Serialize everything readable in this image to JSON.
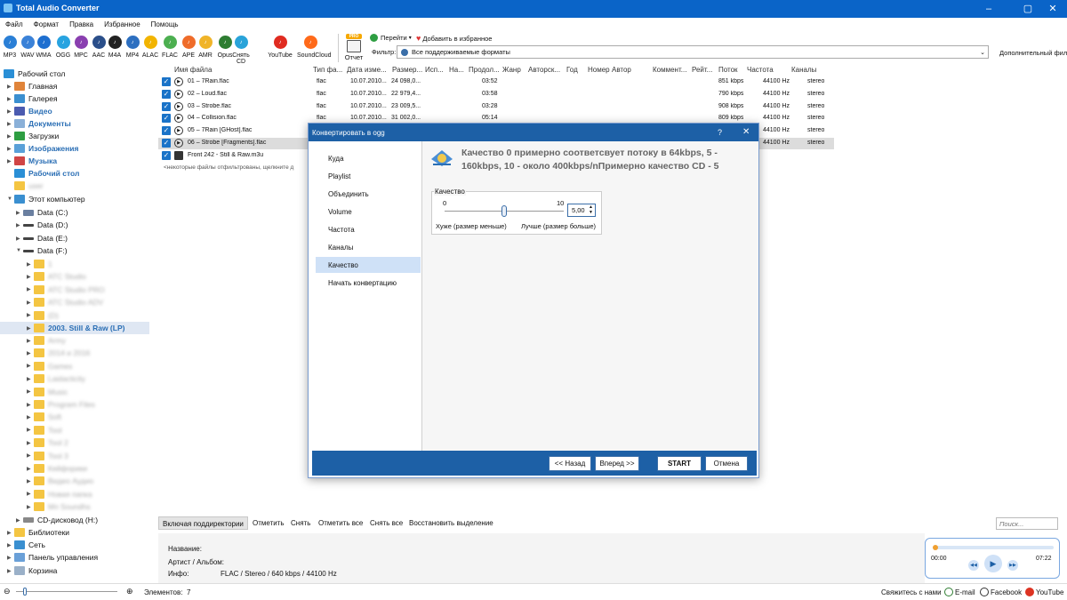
{
  "window": {
    "title": "Total Audio Converter",
    "controls": [
      "–",
      "▢",
      "✕"
    ]
  },
  "menu": [
    "Файл",
    "Формат",
    "Правка",
    "Избранное",
    "Помощь"
  ],
  "formats": [
    {
      "label": "MP3",
      "color": "#2a7fd6"
    },
    {
      "label": "WAV",
      "color": "#3b82d8"
    },
    {
      "label": "WMA",
      "color": "#1e6fd0"
    },
    {
      "label": "OGG",
      "color": "#28a3e0"
    },
    {
      "label": "MPC",
      "color": "#8a3fb0"
    },
    {
      "label": "AAC",
      "color": "#2b4f8a"
    },
    {
      "label": "M4A",
      "color": "#222222"
    },
    {
      "label": "MP4",
      "color": "#2d6fc0"
    },
    {
      "label": "ALAC",
      "color": "#f2b400"
    },
    {
      "label": "FLAC",
      "color": "#4caf50"
    },
    {
      "label": "APE",
      "color": "#ef6c2a"
    },
    {
      "label": "AMR",
      "color": "#f0b429"
    },
    {
      "label": "Opus",
      "color": "#2e7d32"
    },
    {
      "label": "Снять CD",
      "color": "#29a3d9"
    },
    {
      "label": "YouTube",
      "color": "#e02b20"
    },
    {
      "label": "SoundCloud",
      "color": "#ff6a1a"
    }
  ],
  "report": {
    "label": "Отчет",
    "badge": "PRO"
  },
  "nav": {
    "goto": "Перейти",
    "fav": "Добавить в избранное",
    "filter_label": "Фильтр:",
    "filter_value": "Все поддерживаемые форматы",
    "advanced": "Дополнительный фильт"
  },
  "tree": {
    "desktop": "Рабочий стол",
    "home": "Главная",
    "gallery": "Галерея",
    "video": "Видео",
    "docs": "Документы",
    "downloads": "Загрузки",
    "images": "Изображения",
    "music": "Музыка",
    "desktop2": "Рабочий стол",
    "blurred_user": "user",
    "pc": "Этот компьютер",
    "drives": [
      "Data (C:)",
      "Data (D:)",
      "Data (E:)",
      "Data (F:)"
    ],
    "folders_before": [
      "1",
      "ATC Studio",
      "ATC Studio PRO",
      "ATC Studio ADV",
      "(D)"
    ],
    "selected_folder": "2003. Still & Raw (LP)",
    "folders_after": [
      "Army",
      "2014 и 2016",
      "Games",
      "Laidacticity",
      "Music",
      "Program Files",
      "Soft",
      "Tool",
      "Tool 2",
      "Tool 3",
      "Кейфорики",
      "Видео Аудио",
      "Новая папка",
      "Мп Soundhs"
    ],
    "cd": "CD-дисковод (H:)",
    "libraries": "Библиотеки",
    "network": "Сеть",
    "control": "Панель управления",
    "trash": "Корзина"
  },
  "columns": [
    "Имя файла",
    "Тип фа...",
    "Дата изме...",
    "Размер...",
    "Исп...",
    "На...",
    "Продол...",
    "Жанр",
    "Авторск...",
    "Год",
    "Номер",
    "Автор",
    "Коммент...",
    "Рейт...",
    "Поток",
    "Частота",
    "Каналы"
  ],
  "files": [
    {
      "name": "01 – 7Rain.flac",
      "type": "flac",
      "date": "10.07.2010...",
      "size": "24 098,0...",
      "dur": "03:52",
      "bitrate": "851 kbps",
      "freq": "44100 Hz",
      "ch": "stereo",
      "checked": true,
      "selected": false
    },
    {
      "name": "02 – Loud.flac",
      "type": "flac",
      "date": "10.07.2010...",
      "size": "22 979,4...",
      "dur": "03:58",
      "bitrate": "790 kbps",
      "freq": "44100 Hz",
      "ch": "stereo",
      "checked": true,
      "selected": false
    },
    {
      "name": "03 – Strobe.flac",
      "type": "flac",
      "date": "10.07.2010...",
      "size": "23 009,5...",
      "dur": "03:28",
      "bitrate": "908 kbps",
      "freq": "44100 Hz",
      "ch": "stereo",
      "checked": true,
      "selected": false
    },
    {
      "name": "04 – Collision.flac",
      "type": "flac",
      "date": "10.07.2010...",
      "size": "31 002,0...",
      "dur": "05:14",
      "bitrate": "809 kbps",
      "freq": "44100 Hz",
      "ch": "stereo",
      "checked": true,
      "selected": false
    },
    {
      "name": "05 – 7Rain [GHost].flac",
      "type": "flac",
      "date": "",
      "size": "",
      "dur": "",
      "bitrate": "",
      "freq": "44100 Hz",
      "ch": "stereo",
      "checked": true,
      "selected": false
    },
    {
      "name": "06 – Strobe [Fragments].flac",
      "type": "flac",
      "date": "",
      "size": "",
      "dur": "",
      "bitrate": "",
      "freq": "44100 Hz",
      "ch": "stereo",
      "checked": true,
      "selected": true
    },
    {
      "name": "Front 242 - Still & Raw.m3u",
      "type": "",
      "date": "",
      "size": "",
      "dur": "",
      "bitrate": "",
      "freq": "",
      "ch": "",
      "checked": true,
      "selected": false
    }
  ],
  "filtered_note": "<некоторые файлы отфильтрованы, щелкните д",
  "dialog": {
    "title": "Конвертировать в ogg",
    "help": "?",
    "close": "✕",
    "nav": [
      "Куда",
      "Playlist",
      "Объединить",
      "Volume",
      "Частота",
      "Каналы",
      "Качество",
      "Начать конвертацию"
    ],
    "active_index": 6,
    "description": "Качество 0 примерно соответсвует потоку в 64kbps, 5 - 160kbps, 10 - около 400kbps/nПримерно качество CD - 5",
    "group_label": "Качество",
    "min": "0",
    "max": "10",
    "value": "5,00",
    "slider_fraction": 0.5,
    "worse": "Хуже (размер меньше)",
    "better": "Лучше (размер больше)",
    "back": "<< Назад",
    "next": "Вперед >>",
    "start": "START",
    "cancel": "Отмена"
  },
  "bottom": {
    "include": "Включая поддиректории",
    "mark": "Отметить",
    "unmark": "Снять",
    "mark_all": "Отметить все",
    "unmark_all": "Снять все",
    "restore": "Восстановить выделение",
    "search_placeholder": "Поиск..."
  },
  "info": {
    "name_label": "Название:",
    "artist_label": "Артист / Альбом:",
    "info_label": "Инфо:",
    "info_value": "FLAC / Stereo / 640 kbps / 44100 Hz"
  },
  "player": {
    "start": "00:00",
    "end": "07:22"
  },
  "status": {
    "elements_label": "Элементов:",
    "elements_count": "7",
    "contact": "Свяжитесь с нами",
    "email": "E-mail",
    "facebook": "Facebook",
    "youtube": "YouTube"
  }
}
